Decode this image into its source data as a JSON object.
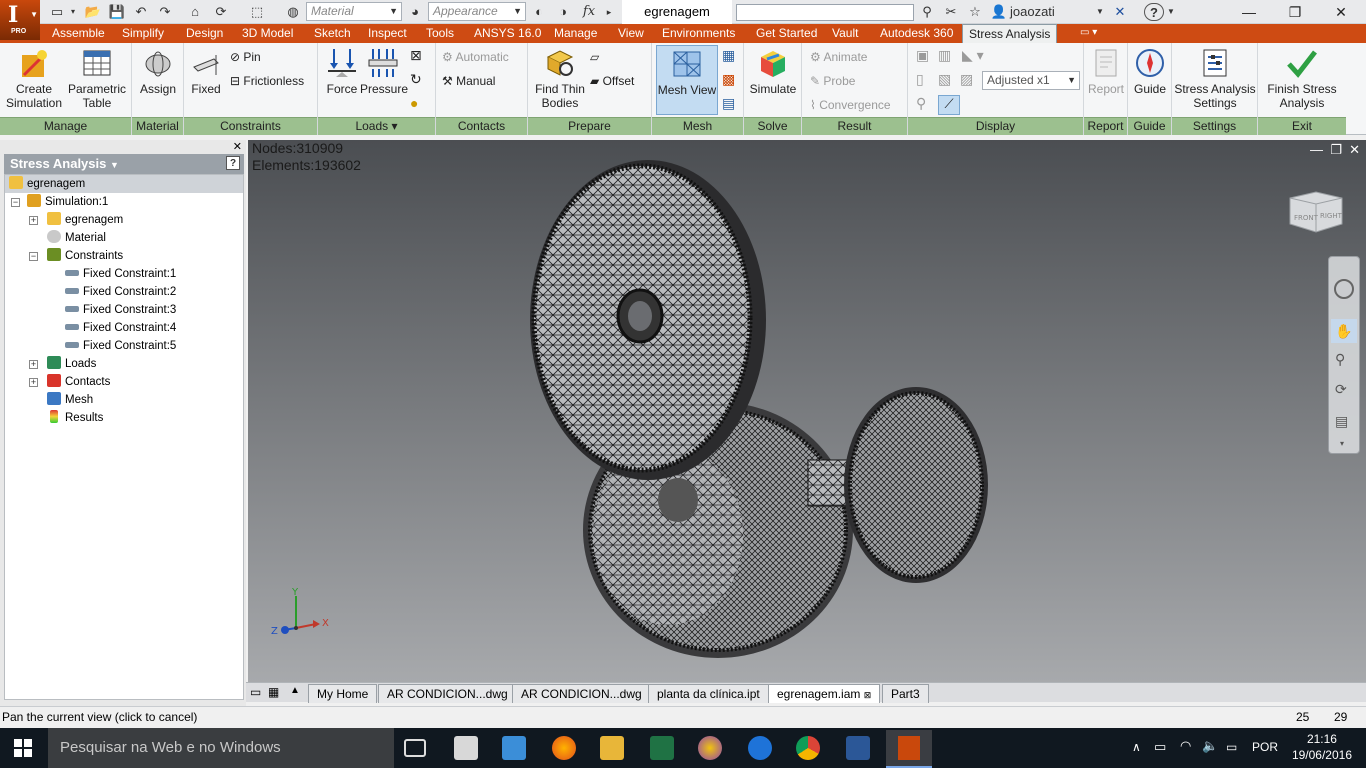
{
  "titlebar": {
    "logo_letter": "I",
    "logo_edition": "PRO",
    "material_combo": "Material",
    "appearance_combo": "Appearance",
    "fx_label": "fx",
    "doc_title": "egrenagem",
    "user_name": "joaozati",
    "help_label": "?"
  },
  "ribbon_tabs": [
    "Assemble",
    "Simplify",
    "Design",
    "3D Model",
    "Sketch",
    "Inspect",
    "Tools",
    "ANSYS 16.0",
    "Manage",
    "View",
    "Environments",
    "Get Started",
    "Vault",
    "Autodesk 360",
    "Stress Analysis"
  ],
  "ribbon": {
    "manage": {
      "label": "Manage",
      "create_simulation": "Create Simulation",
      "parametric_table": "Parametric Table"
    },
    "material": {
      "label": "Material",
      "assign": "Assign"
    },
    "constraints": {
      "label": "Constraints",
      "fixed": "Fixed",
      "pin": "Pin",
      "frictionless": "Frictionless"
    },
    "loads": {
      "label": "Loads",
      "force": "Force",
      "pressure": "Pressure"
    },
    "contacts": {
      "label": "Contacts",
      "automatic": "Automatic",
      "manual": "Manual"
    },
    "prepare": {
      "label": "Prepare",
      "find_thin_bodies": "Find Thin Bodies",
      "offset": "Offset"
    },
    "mesh": {
      "label": "Mesh",
      "mesh_view": "Mesh View"
    },
    "solve": {
      "label": "Solve",
      "simulate": "Simulate"
    },
    "result": {
      "label": "Result",
      "animate": "Animate",
      "probe": "Probe",
      "convergence": "Convergence"
    },
    "display": {
      "label": "Display",
      "adjusted": "Adjusted x1"
    },
    "report": {
      "label": "Report",
      "report": "Report"
    },
    "guide": {
      "label": "Guide",
      "guide": "Guide"
    },
    "settings": {
      "label": "Settings",
      "stress_analysis_settings": "Stress Analysis Settings"
    },
    "exit": {
      "label": "Exit",
      "finish_stress_analysis": "Finish Stress Analysis"
    }
  },
  "browser": {
    "title": "Stress Analysis",
    "nodes": [
      "egrenagem",
      "Simulation:1",
      "egrenagem",
      "Material",
      "Constraints",
      "Fixed Constraint:1",
      "Fixed Constraint:2",
      "Fixed Constraint:3",
      "Fixed Constraint:4",
      "Fixed Constraint:5",
      "Loads",
      "Contacts",
      "Mesh",
      "Results"
    ]
  },
  "viewport": {
    "nodes_text": "Nodes:310909",
    "elements_text": "Elements:193602",
    "axis_x": "X",
    "axis_y": "Y",
    "axis_z": "Z",
    "viewcube_front": "FRONT",
    "viewcube_right": "RIGHT"
  },
  "document_tabs": [
    "My Home",
    "AR CONDICION...dwg",
    "AR CONDICION...dwg",
    "planta da clínica.ipt",
    "egrenagem.iam",
    "Part3"
  ],
  "statusbar": {
    "message": "Pan the current view (click to cancel)",
    "count_a": "25",
    "count_b": "29"
  },
  "taskbar": {
    "search_placeholder": "Pesquisar na Web e no Windows",
    "language": "POR",
    "time": "21:16",
    "date": "19/06/2016"
  },
  "colors": {
    "ribbon_tab_bg": "#ce4b13",
    "panel_label_bg": "#9cc08f",
    "taskbar_bg": "#101820"
  }
}
